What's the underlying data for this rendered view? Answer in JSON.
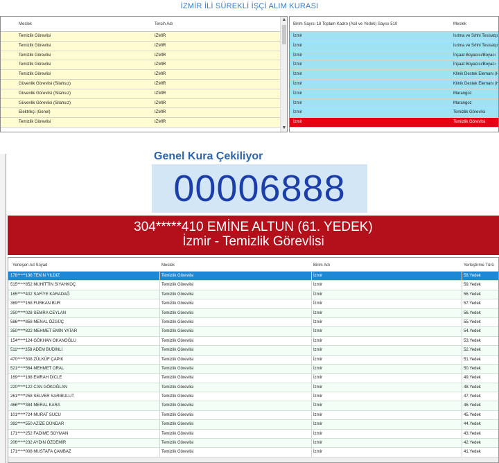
{
  "title": "İZMİR İLİ SÜREKLİ İŞÇİ ALIM KURASI",
  "top_left": {
    "headers": {
      "meslek": "Meslek",
      "tercih": "Tercih Adı"
    },
    "rows": [
      {
        "meslek": "Temizlik Görevlisi",
        "tercih": "IZMIR"
      },
      {
        "meslek": "Temizlik Görevlisi",
        "tercih": "IZMIR"
      },
      {
        "meslek": "Temizlik Görevlisi",
        "tercih": "IZMIR"
      },
      {
        "meslek": "Temizlik Görevlisi",
        "tercih": "IZMIR"
      },
      {
        "meslek": "Temizlik Görevlisi",
        "tercih": "IZMIR"
      },
      {
        "meslek": "Güvenlik Görevlisi (Silahsız)",
        "tercih": "IZMIR"
      },
      {
        "meslek": "Güvenlik Görevlisi (Silahsız)",
        "tercih": "IZMIR"
      },
      {
        "meslek": "Güvenlik Görevlisi (Silahsız)",
        "tercih": "IZMIR"
      },
      {
        "meslek": "Elektrikçi (Genel)",
        "tercih": "IZMIR"
      },
      {
        "meslek": "Temizlik Görevlisi",
        "tercih": "IZMIR"
      }
    ]
  },
  "top_right": {
    "headers": {
      "birim": "Birim Sayısı 18 Toplam Kadro (Asil ve Yedek) Sayısı 510",
      "meslek": "Meslek"
    },
    "rows": [
      {
        "birim": "İzmir",
        "meslek": "Isıtma ve Sıhhi Tesisatçı"
      },
      {
        "birim": "İzmir",
        "meslek": "Isıtma ve Sıhhi Tesisatçı"
      },
      {
        "birim": "İzmir",
        "meslek": "İnşaat Boyacısı/Boyacı"
      },
      {
        "birim": "İzmir",
        "meslek": "İnşaat Boyacısı/Boyacı"
      },
      {
        "birim": "İzmir",
        "meslek": "Klinik Destek Elemanı (H"
      },
      {
        "birim": "İzmir",
        "meslek": "Klinik Destek Elemanı (H"
      },
      {
        "birim": "İzmir",
        "meslek": "Marangoz"
      },
      {
        "birim": "İzmir",
        "meslek": "Marangoz"
      },
      {
        "birim": "İzmir",
        "meslek": "Temizlik Görevlisi"
      },
      {
        "birim": "İzmir",
        "meslek": "Temizlik Görevlisi",
        "selected": true
      }
    ]
  },
  "draw": {
    "label": "Genel Kura Çekiliyor",
    "number": "00006888",
    "winner_line": "304*****410 EMİNE ALTUN (61. YEDEK)",
    "winner_place": "İzmir - Temizlik Görevlisi"
  },
  "bottom": {
    "headers": {
      "name": "Yerleşen Ad Soyad",
      "meslek": "Meslek",
      "birim": "Birim Adı",
      "tur": "Yerleştirme Türü"
    },
    "rows": [
      {
        "name": "178*****136 TEKİN YILDIZ",
        "meslek": "Temizlik Görevlisi",
        "birim": "İzmir",
        "tur": "58.Yedek",
        "selected": true
      },
      {
        "name": "515*****852 MUHİTTİN SIYAHKOÇ",
        "meslek": "Temizlik Görevlisi",
        "birim": "İzmir",
        "tur": "59.Yedek"
      },
      {
        "name": "165*****402 SAFİYE KARADAĞ",
        "meslek": "Temizlik Görevlisi",
        "birim": "İzmir",
        "tur": "56.Yedek"
      },
      {
        "name": "369*****158 FURKAN BUR",
        "meslek": "Temizlik Görevlisi",
        "birim": "İzmir",
        "tur": "57.Yedek"
      },
      {
        "name": "250*****028 SEMRA CEYLAN",
        "meslek": "Temizlik Görevlisi",
        "birim": "İzmir",
        "tur": "56.Yedek"
      },
      {
        "name": "586*****858 MENAL ÖZGÜÇ",
        "meslek": "Temizlik Görevlisi",
        "birim": "İzmir",
        "tur": "55.Yedek"
      },
      {
        "name": "350*****822 MEHMET EMİN YATAR",
        "meslek": "Temizlik Görevlisi",
        "birim": "İzmir",
        "tur": "54.Yedek"
      },
      {
        "name": "154*****124 GÖKHAN OKANOĞLU",
        "meslek": "Temizlik Görevlisi",
        "birim": "İzmir",
        "tur": "53.Yedek"
      },
      {
        "name": "511*****358 ADEM BUDİNLİ",
        "meslek": "Temizlik Görevlisi",
        "birim": "İzmir",
        "tur": "52.Yedek"
      },
      {
        "name": "470*****308 ZÜLKÜF ÇAPIK",
        "meslek": "Temizlik Görevlisi",
        "birim": "İzmir",
        "tur": "51.Yedek"
      },
      {
        "name": "521*****564 MEHMET ORAL",
        "meslek": "Temizlik Görevlisi",
        "birim": "İzmir",
        "tur": "50.Yedek"
      },
      {
        "name": "169*****188 EMRAH DİCLE",
        "meslek": "Temizlik Görevlisi",
        "birim": "İzmir",
        "tur": "49.Yedek"
      },
      {
        "name": "220*****122 CAN GÖKOĞLAN",
        "meslek": "Temizlik Görevlisi",
        "birim": "İzmir",
        "tur": "48.Yedek"
      },
      {
        "name": "261*****258 SELVER SARIBULUT",
        "meslek": "Temizlik Görevlisi",
        "birim": "İzmir",
        "tur": "47.Yedek"
      },
      {
        "name": "466*****384 MERAL KARA",
        "meslek": "Temizlik Görevlisi",
        "birim": "İzmir",
        "tur": "46.Yedek"
      },
      {
        "name": "101*****724 MURAT SUCU",
        "meslek": "Temizlik Görevlisi",
        "birim": "İzmir",
        "tur": "45.Yedek"
      },
      {
        "name": "392*****550 AZİZE DÜNDAR",
        "meslek": "Temizlik Görevlisi",
        "birim": "İzmir",
        "tur": "44.Yedek"
      },
      {
        "name": "171*****252 FADİME SOYMAN",
        "meslek": "Temizlik Görevlisi",
        "birim": "İzmir",
        "tur": "43.Yedek"
      },
      {
        "name": "206*****232 AYDIN ÖZDEMİR",
        "meslek": "Temizlik Görevlisi",
        "birim": "İzmir",
        "tur": "42.Yedek"
      },
      {
        "name": "171*****008 MUSTAFA ÇAMBAZ",
        "meslek": "Temizlik Görevlisi",
        "birim": "İzmir",
        "tur": "41.Yedek"
      }
    ]
  },
  "colors": {
    "title": "#3b7bc2",
    "tl_row": "#fffcd2",
    "tr_row": "#9fe3f2",
    "tr_selected": "#e60012",
    "counter_bg": "#d3e6f6",
    "counter_text": "#1b3ea8",
    "banner": "#b3101c",
    "bottom_selected": "#1e87d6"
  },
  "icons": {
    "scroll_up": "▲",
    "scroll_down": "▼"
  }
}
